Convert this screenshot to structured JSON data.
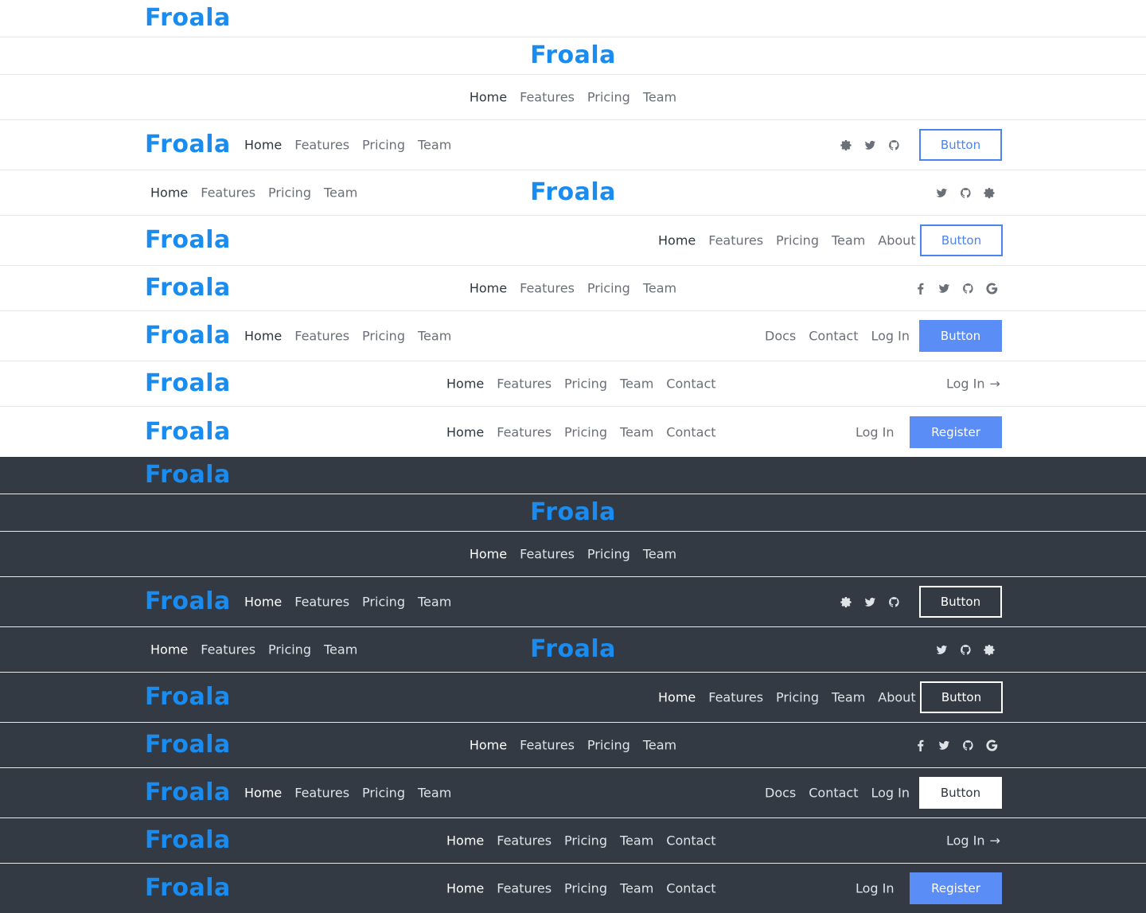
{
  "brand": {
    "logo_text": "Froala",
    "logo_color": "#1a8cf0"
  },
  "colors": {
    "dark_bg": "#333a44",
    "light_bg": "#ffffff",
    "accent": "#5b8df6"
  },
  "nav": {
    "home": "Home",
    "features": "Features",
    "pricing": "Pricing",
    "team": "Team",
    "about": "About",
    "contact": "Contact",
    "docs": "Docs",
    "login": "Log In",
    "login_arrow": "→"
  },
  "buttons": {
    "button": "Button",
    "register": "Register"
  },
  "icons": [
    "gear-icon",
    "twitter-icon",
    "github-icon",
    "facebook-icon",
    "google-icon"
  ]
}
